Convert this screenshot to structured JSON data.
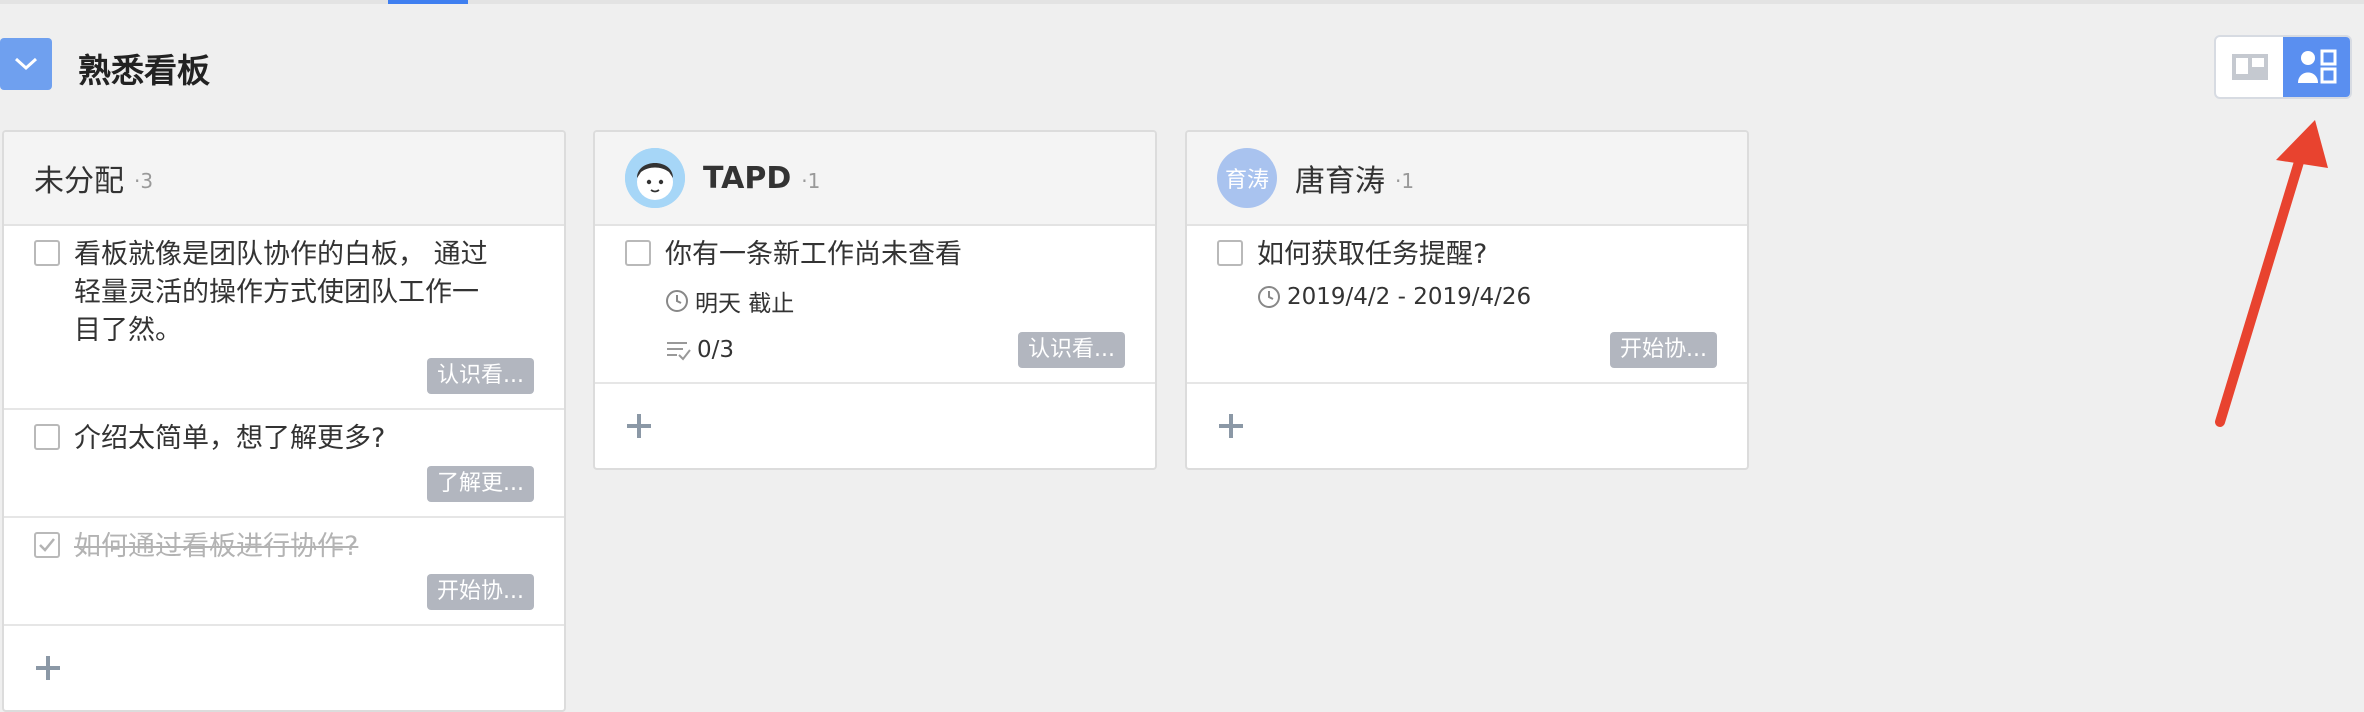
{
  "board": {
    "title": "熟悉看板"
  },
  "columns": [
    {
      "name": "未分配",
      "count": "·3",
      "cards": [
        {
          "title": "看板就像是团队协作的白板， 通过轻量灵活的操作方式使团队工作一目了然。",
          "tag": "认识看...",
          "done": false
        },
        {
          "title": "介绍太简单，想了解更多?",
          "tag": "了解更...",
          "done": false
        },
        {
          "title": "如何通过看板进行协作?",
          "tag": "开始协...",
          "done": true
        }
      ]
    },
    {
      "name": "TAPD",
      "count": "·1",
      "cards": [
        {
          "title": "你有一条新工作尚未查看",
          "due": "明天 截止",
          "subtasks": "0/3",
          "tag": "认识看...",
          "done": false
        }
      ]
    },
    {
      "name": "唐育涛",
      "avatar_text": "育涛",
      "count": "·1",
      "cards": [
        {
          "title": "如何获取任务提醒?",
          "date_range": "2019/4/2 - 2019/4/26",
          "tag": "开始协...",
          "done": false
        }
      ]
    }
  ],
  "add_symbol": "+",
  "colors": {
    "accent": "#5a8ff0",
    "tag": "#b2b6bf",
    "arrow": "#e8432f"
  }
}
